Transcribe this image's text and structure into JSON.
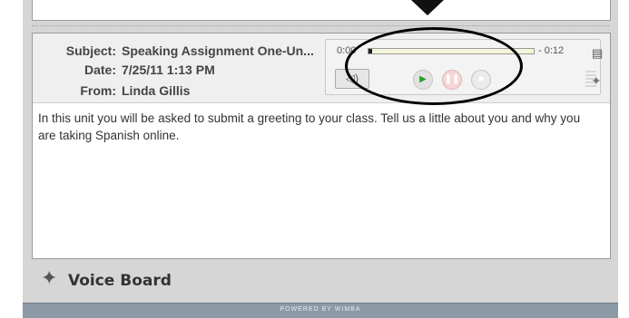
{
  "message": {
    "subject_label": "Subject:",
    "subject_value": "Speaking Assignment One-Un...",
    "date_label": "Date:",
    "date_value": "7/25/11 1:13 PM",
    "from_label": "From:",
    "from_value": "Linda Gillis",
    "body": "In this unit you will be asked to submit a greeting to your class. Tell us a little about you and why you are taking Spanish online."
  },
  "player": {
    "time_start": "0:00",
    "time_end": "- 0:12",
    "progress": 0.02,
    "volume_icon": "speaker-icon",
    "play_icon": "play-icon",
    "pause_icon": "pause-icon",
    "stop_icon": "stop-icon"
  },
  "voice_board": {
    "title": "Voice Board",
    "icon": "people-icon"
  },
  "footer": {
    "text": "POWERED BY WIMBA"
  },
  "colors": {
    "frame": "#d6d6d6",
    "footer": "#8c9aa6",
    "play": "#2ca02c",
    "annotation": "#000000"
  }
}
